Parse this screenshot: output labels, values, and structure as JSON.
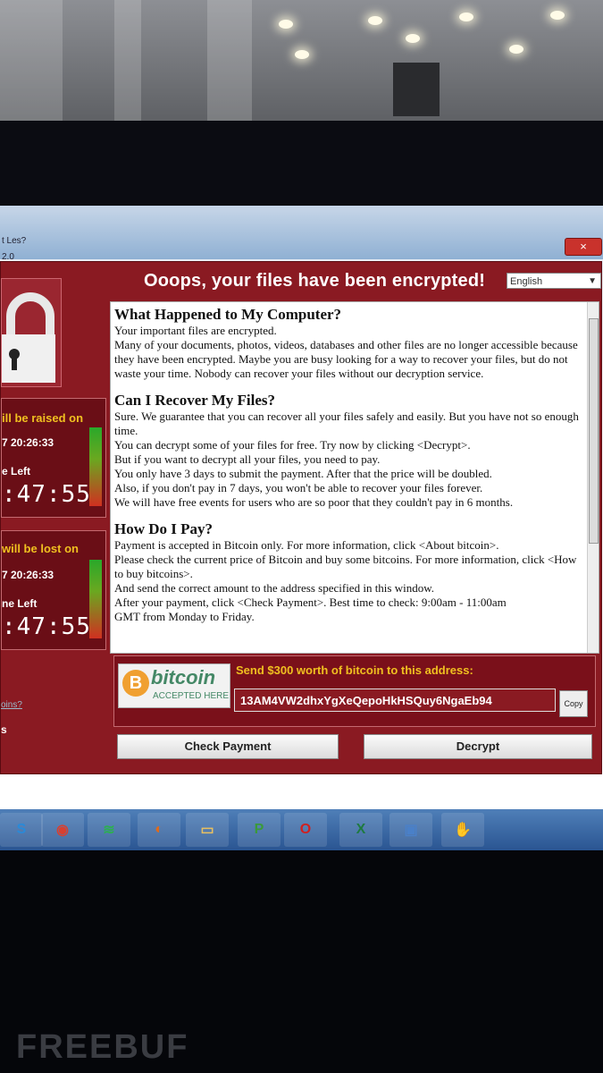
{
  "window": {
    "title_fragment": "t Les?",
    "version_fragment": "2.0",
    "headline": "Ooops, your files have been encrypted!",
    "language": "English",
    "close": "×"
  },
  "left_panel": {
    "raise": {
      "label": "ill be raised on",
      "date": "7 20:26:33",
      "time_left_label": "e Left",
      "timer": ":47:55"
    },
    "lost": {
      "label": " will be lost on",
      "date": "7 20:26:33",
      "time_left_label": "ne Left",
      "timer": ":47:55"
    },
    "link": "oins?",
    "link2": "s"
  },
  "content": {
    "sections": [
      {
        "heading": "What Happened to My Computer?",
        "lines": [
          "Your important files are encrypted.",
          "Many of your documents, photos, videos, databases and other files are no longer accessible because they have been encrypted. Maybe you are busy looking for a way to recover your files, but do not waste your time. Nobody can recover your files without our decryption service."
        ]
      },
      {
        "heading": "Can I Recover My Files?",
        "lines": [
          "Sure. We guarantee that you can recover all your files safely and easily. But you have not so enough time.",
          "You can decrypt some of your files for free. Try now by clicking <Decrypt>.",
          "But if you want to decrypt all your files, you need to pay.",
          "You only have 3 days to submit the payment. After that the price will be doubled.",
          "Also, if you don't pay in 7 days, you won't be able to recover your files forever.",
          "We will have free events for users who are so poor that they couldn't pay in 6 months."
        ]
      },
      {
        "heading": "How Do I Pay?",
        "lines": [
          "Payment is accepted in Bitcoin only. For more information, click <About bitcoin>.",
          "Please check the current price of Bitcoin and buy some bitcoins. For more information, click <How to buy bitcoins>.",
          "And send the correct amount to the address specified in this window.",
          "After your payment, click <Check Payment>. Best time to check: 9:00am - 11:00am",
          "GMT from Monday to Friday."
        ]
      }
    ]
  },
  "bitcoin": {
    "logo_symbol": "B",
    "logo_word": "bitcoin",
    "accepted": "ACCEPTED HERE",
    "send_label": "Send $300 worth of bitcoin to this address:",
    "address": "13AM4VW2dhxYgXeQepoHkHSQuy6NgaEb94",
    "copy": "Copy"
  },
  "buttons": {
    "check_payment": "Check Payment",
    "decrypt": "Decrypt"
  },
  "taskbar": {
    "items": [
      {
        "name": "skype-icon",
        "glyph": "S",
        "color": "#2a8ad8"
      },
      {
        "name": "chrome-icon",
        "glyph": "◉",
        "color": "#d84030"
      },
      {
        "name": "spotify-icon",
        "glyph": "≋",
        "color": "#2cb050"
      },
      {
        "name": "firefox-icon",
        "glyph": "◐",
        "color": "#e06a1a"
      },
      {
        "name": "folder-icon",
        "glyph": "▭",
        "color": "#e8c060"
      },
      {
        "name": "vpn-icon",
        "glyph": "P",
        "color": "#3a9a3a"
      },
      {
        "name": "opera-icon",
        "glyph": "O",
        "color": "#d02020"
      },
      {
        "name": "excel-icon",
        "glyph": "X",
        "color": "#1e7a40"
      },
      {
        "name": "window-icon",
        "glyph": "▣",
        "color": "#4a80c8"
      },
      {
        "name": "handshake-icon",
        "glyph": "✋",
        "color": "#c8b080"
      }
    ]
  },
  "watermark": "FREEBUF"
}
